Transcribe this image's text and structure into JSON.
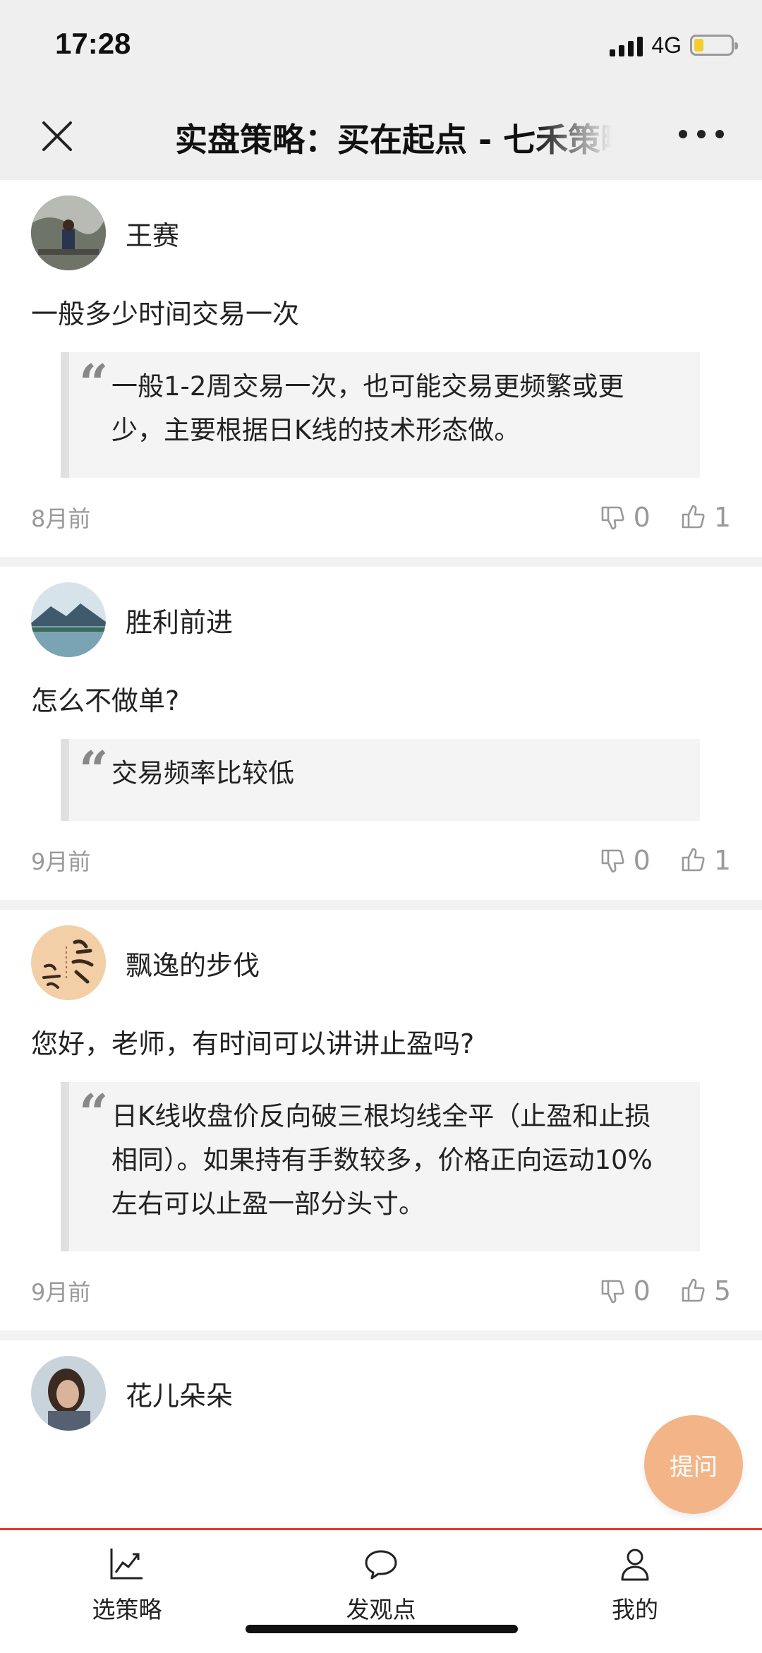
{
  "status_bar": {
    "time": "17:28",
    "network": "4G",
    "battery_level": 0.25
  },
  "nav": {
    "title": "实盘策略：买在起点 - 七禾策略"
  },
  "comments": [
    {
      "username": "王赛",
      "question": "一般多少时间交易一次",
      "answer": "一般1-2周交易一次，也可能交易更频繁或更少，主要根据日K线的技术形态做。",
      "time_ago": "8月前",
      "downvotes": "0",
      "upvotes": "1"
    },
    {
      "username": "胜利前进",
      "question": "怎么不做单?",
      "answer": "交易频率比较低",
      "time_ago": "9月前",
      "downvotes": "0",
      "upvotes": "1"
    },
    {
      "username": "飘逸的步伐",
      "question": "您好，老师，有时间可以讲讲止盈吗?",
      "answer": "日K线收盘价反向破三根均线全平（止盈和止损相同）。如果持有手数较多，价格正向运动10%左右可以止盈一部分头寸。",
      "time_ago": "9月前",
      "downvotes": "0",
      "upvotes": "5"
    },
    {
      "username": "花儿朵朵"
    }
  ],
  "ask_button": "提问",
  "tabs": [
    {
      "label": "选策略",
      "icon": "chart-line-icon"
    },
    {
      "label": "发观点",
      "icon": "speech-bubble-icon"
    },
    {
      "label": "我的",
      "icon": "user-icon"
    }
  ],
  "colors": {
    "accent": "#e03a2c",
    "ask_button": "#f3b587",
    "muted": "#999999"
  }
}
